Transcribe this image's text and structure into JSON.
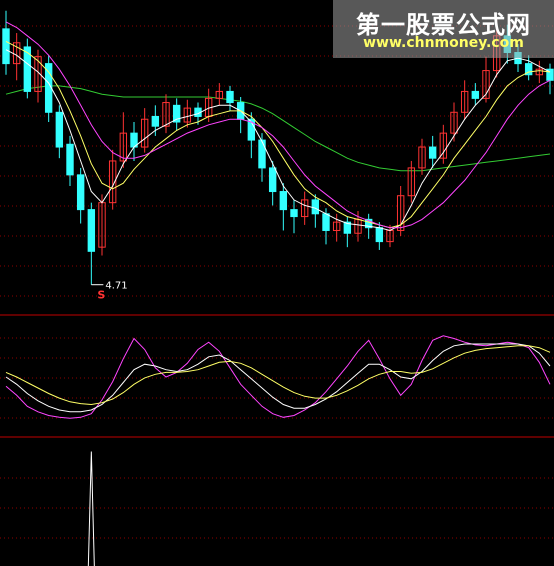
{
  "watermark": {
    "title": "第一股票公式网",
    "url": "www.chnmoney.com"
  },
  "colors": {
    "background": "#000000",
    "grid": "#8b0000",
    "separator": "#c00000",
    "candle_up": "#ff3333",
    "candle_down": "#33ffff",
    "ma_short": "#ffffff",
    "ma_mid": "#ffff66",
    "ma_long": "#ff44ff",
    "ma_xlong": "#33cc33",
    "signal_marker": "#ff3333",
    "low_label": "#ffffff"
  },
  "chart_data": [
    {
      "type": "candlestick",
      "panel": "price",
      "title": "",
      "ylim": [
        4.6,
        6.7
      ],
      "grid": "horizontal dotted",
      "low_annotation": {
        "text": "4.71",
        "value": 4.71,
        "index": 8
      },
      "signal_marker": {
        "text": "S",
        "index": 8
      },
      "candles": [
        [
          6.55,
          6.3,
          6.68,
          6.22
        ],
        [
          6.3,
          6.45,
          6.52,
          6.18
        ],
        [
          6.42,
          6.1,
          6.48,
          6.05
        ],
        [
          6.1,
          6.35,
          6.4,
          6.02
        ],
        [
          6.3,
          5.95,
          6.36,
          5.88
        ],
        [
          5.95,
          5.7,
          6.0,
          5.62
        ],
        [
          5.72,
          5.5,
          5.78,
          5.42
        ],
        [
          5.5,
          5.25,
          5.55,
          5.15
        ],
        [
          5.25,
          4.95,
          5.3,
          4.71
        ],
        [
          4.98,
          5.3,
          5.36,
          4.92
        ],
        [
          5.3,
          5.6,
          5.68,
          5.25
        ],
        [
          5.6,
          5.8,
          5.95,
          5.55
        ],
        [
          5.8,
          5.7,
          5.88,
          5.6
        ],
        [
          5.7,
          5.9,
          5.98,
          5.66
        ],
        [
          5.92,
          5.85,
          6.0,
          5.78
        ],
        [
          5.85,
          6.02,
          6.08,
          5.8
        ],
        [
          6.0,
          5.88,
          6.05,
          5.82
        ],
        [
          5.88,
          5.98,
          6.04,
          5.84
        ],
        [
          5.98,
          5.92,
          6.02,
          5.86
        ],
        [
          5.92,
          6.05,
          6.12,
          5.88
        ],
        [
          6.05,
          6.1,
          6.16,
          6.0
        ],
        [
          6.1,
          6.02,
          6.14,
          5.96
        ],
        [
          6.02,
          5.9,
          6.06,
          5.8
        ],
        [
          5.9,
          5.75,
          5.95,
          5.62
        ],
        [
          5.75,
          5.55,
          5.8,
          5.45
        ],
        [
          5.55,
          5.38,
          5.6,
          5.28
        ],
        [
          5.38,
          5.25,
          5.44,
          5.1
        ],
        [
          5.25,
          5.2,
          5.32,
          5.08
        ],
        [
          5.2,
          5.32,
          5.38,
          5.14
        ],
        [
          5.32,
          5.22,
          5.36,
          5.12
        ],
        [
          5.22,
          5.1,
          5.26,
          5.0
        ],
        [
          5.1,
          5.16,
          5.22,
          5.02
        ],
        [
          5.16,
          5.08,
          5.2,
          4.98
        ],
        [
          5.08,
          5.18,
          5.24,
          5.02
        ],
        [
          5.18,
          5.12,
          5.22,
          5.04
        ],
        [
          5.12,
          5.02,
          5.16,
          4.96
        ],
        [
          5.02,
          5.1,
          5.14,
          4.98
        ],
        [
          5.1,
          5.35,
          5.42,
          5.06
        ],
        [
          5.35,
          5.55,
          5.6,
          5.3
        ],
        [
          5.55,
          5.7,
          5.76,
          5.5
        ],
        [
          5.7,
          5.62,
          5.78,
          5.55
        ],
        [
          5.62,
          5.8,
          5.86,
          5.58
        ],
        [
          5.8,
          5.95,
          6.02,
          5.74
        ],
        [
          5.95,
          6.1,
          6.18,
          5.9
        ],
        [
          6.1,
          6.05,
          6.16,
          6.0
        ],
        [
          6.05,
          6.25,
          6.35,
          6.02
        ],
        [
          6.25,
          6.5,
          6.62,
          6.2
        ],
        [
          6.5,
          6.38,
          6.58,
          6.3
        ],
        [
          6.38,
          6.3,
          6.44,
          6.24
        ],
        [
          6.3,
          6.22,
          6.36,
          6.18
        ],
        [
          6.22,
          6.26,
          6.32,
          6.16
        ],
        [
          6.26,
          6.18,
          6.3,
          6.08
        ]
      ],
      "series": [
        {
          "values": [
            6.4,
            6.36,
            6.3,
            6.24,
            6.16,
            6.02,
            5.82,
            5.6,
            5.38,
            5.3,
            5.42,
            5.58,
            5.7,
            5.76,
            5.82,
            5.86,
            5.9,
            5.92,
            5.94,
            5.98,
            6.0,
            6.0,
            5.96,
            5.88,
            5.74,
            5.58,
            5.42,
            5.32,
            5.28,
            5.26,
            5.22,
            5.18,
            5.15,
            5.14,
            5.13,
            5.12,
            5.1,
            5.14,
            5.28,
            5.44,
            5.56,
            5.66,
            5.78,
            5.9,
            6.0,
            6.08,
            6.22,
            6.32,
            6.34,
            6.32,
            6.28,
            6.24
          ]
        },
        {
          "values": [
            6.46,
            6.42,
            6.38,
            6.32,
            6.24,
            6.12,
            5.96,
            5.78,
            5.58,
            5.44,
            5.4,
            5.44,
            5.54,
            5.62,
            5.7,
            5.76,
            5.82,
            5.86,
            5.88,
            5.92,
            5.94,
            5.96,
            5.96,
            5.92,
            5.84,
            5.74,
            5.62,
            5.5,
            5.4,
            5.34,
            5.3,
            5.24,
            5.2,
            5.18,
            5.16,
            5.14,
            5.12,
            5.14,
            5.2,
            5.3,
            5.4,
            5.5,
            5.62,
            5.72,
            5.82,
            5.92,
            6.04,
            6.14,
            6.2,
            6.24,
            6.25,
            6.24
          ]
        },
        {
          "values": [
            6.6,
            6.56,
            6.5,
            6.44,
            6.36,
            6.26,
            6.14,
            6.0,
            5.86,
            5.74,
            5.66,
            5.62,
            5.62,
            5.64,
            5.68,
            5.72,
            5.76,
            5.8,
            5.83,
            5.86,
            5.88,
            5.9,
            5.9,
            5.88,
            5.84,
            5.78,
            5.7,
            5.6,
            5.5,
            5.42,
            5.36,
            5.3,
            5.24,
            5.2,
            5.17,
            5.14,
            5.12,
            5.12,
            5.14,
            5.18,
            5.24,
            5.3,
            5.38,
            5.46,
            5.56,
            5.66,
            5.78,
            5.9,
            6.0,
            6.08,
            6.14,
            6.18
          ]
        },
        {
          "values": [
            6.08,
            6.1,
            6.12,
            6.13,
            6.14,
            6.14,
            6.13,
            6.12,
            6.1,
            6.08,
            6.07,
            6.06,
            6.06,
            6.06,
            6.06,
            6.06,
            6.06,
            6.06,
            6.06,
            6.06,
            6.05,
            6.04,
            6.03,
            6.01,
            5.98,
            5.94,
            5.89,
            5.84,
            5.79,
            5.74,
            5.7,
            5.66,
            5.62,
            5.59,
            5.57,
            5.55,
            5.54,
            5.53,
            5.53,
            5.53,
            5.54,
            5.55,
            5.56,
            5.57,
            5.58,
            5.59,
            5.6,
            5.61,
            5.62,
            5.63,
            5.64,
            5.65
          ]
        }
      ]
    },
    {
      "type": "line",
      "panel": "oscillator",
      "title": "",
      "ylim": [
        -10,
        110
      ],
      "series": [
        {
          "values": [
            40,
            30,
            18,
            12,
            8,
            6,
            5,
            6,
            10,
            25,
            45,
            70,
            92,
            80,
            60,
            50,
            55,
            65,
            80,
            88,
            78,
            60,
            42,
            30,
            18,
            10,
            6,
            8,
            14,
            22,
            34,
            48,
            62,
            78,
            90,
            70,
            48,
            30,
            42,
            68,
            90,
            95,
            92,
            88,
            85,
            84,
            86,
            88,
            86,
            82,
            66,
            42
          ]
        },
        {
          "values": [
            50,
            42,
            32,
            24,
            18,
            14,
            12,
            12,
            14,
            20,
            30,
            44,
            58,
            64,
            62,
            58,
            56,
            58,
            64,
            72,
            74,
            68,
            58,
            48,
            38,
            28,
            20,
            16,
            16,
            20,
            26,
            34,
            44,
            54,
            64,
            64,
            58,
            50,
            48,
            56,
            68,
            78,
            84,
            86,
            86,
            86,
            86,
            86,
            86,
            84,
            76,
            62
          ]
        },
        {
          "values": [
            55,
            50,
            44,
            38,
            32,
            27,
            23,
            21,
            20,
            22,
            26,
            33,
            42,
            49,
            53,
            55,
            55,
            56,
            58,
            62,
            66,
            67,
            65,
            60,
            53,
            46,
            39,
            33,
            29,
            27,
            27,
            30,
            35,
            41,
            48,
            53,
            56,
            56,
            54,
            55,
            59,
            65,
            71,
            76,
            79,
            81,
            82,
            83,
            84,
            84,
            82,
            77
          ]
        }
      ]
    },
    {
      "type": "bar",
      "panel": "signal",
      "title": "",
      "ylim": [
        0,
        1.1
      ],
      "values": [
        0,
        0,
        0,
        0,
        0,
        0,
        0,
        0,
        1,
        0,
        0,
        0,
        0,
        0,
        0,
        0,
        0,
        0,
        0,
        0,
        0,
        0,
        0,
        0,
        0,
        0,
        0,
        0,
        0,
        0,
        0,
        0,
        0,
        0,
        0,
        0,
        0,
        0,
        0,
        0,
        0,
        0,
        0,
        0,
        0,
        0,
        0,
        0,
        0,
        0,
        0,
        0
      ]
    }
  ]
}
